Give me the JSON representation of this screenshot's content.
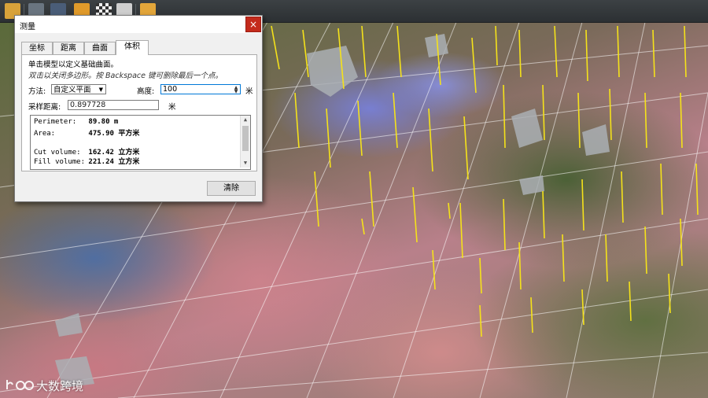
{
  "dialog": {
    "title": "测量",
    "close_label": "×",
    "tabs": [
      {
        "label": "坐标"
      },
      {
        "label": "距离"
      },
      {
        "label": "曲面"
      },
      {
        "label": "体积"
      }
    ],
    "active_tab": "体积",
    "instruction_1": "单击模型以定义基础曲面。",
    "instruction_2": "双击以关闭多边形。按 Backspace 键可删除最后一个点。",
    "method_label": "方法:",
    "method_value": "自定义平面",
    "height_label": "高度:",
    "height_value": "100",
    "height_unit": "米",
    "sample_label": "采样距离:",
    "sample_value": "0.897728",
    "sample_unit": "米",
    "results": [
      {
        "key": "Perimeter:",
        "value": "89.80 m"
      },
      {
        "key": "Area:",
        "value": "475.90 平方米"
      },
      {
        "key": "Cut volume:",
        "value": "162.42 立方米"
      },
      {
        "key": "Fill volume:",
        "value": "221.24 立方米"
      }
    ],
    "clear_button": "清除"
  },
  "toolbar": {
    "icons": [
      "folder-icon",
      "save-icon",
      "navigate-icon",
      "pan-icon",
      "checker-icon",
      "layers-icon",
      "measure-icon"
    ],
    "accent": "#f2c14e"
  },
  "watermark": {
    "text": "大数跨境"
  },
  "colors": {
    "close": "#c42b1c",
    "height_border": "#0078d7",
    "marker": "#f5e21a",
    "grid": "#ffffff"
  }
}
